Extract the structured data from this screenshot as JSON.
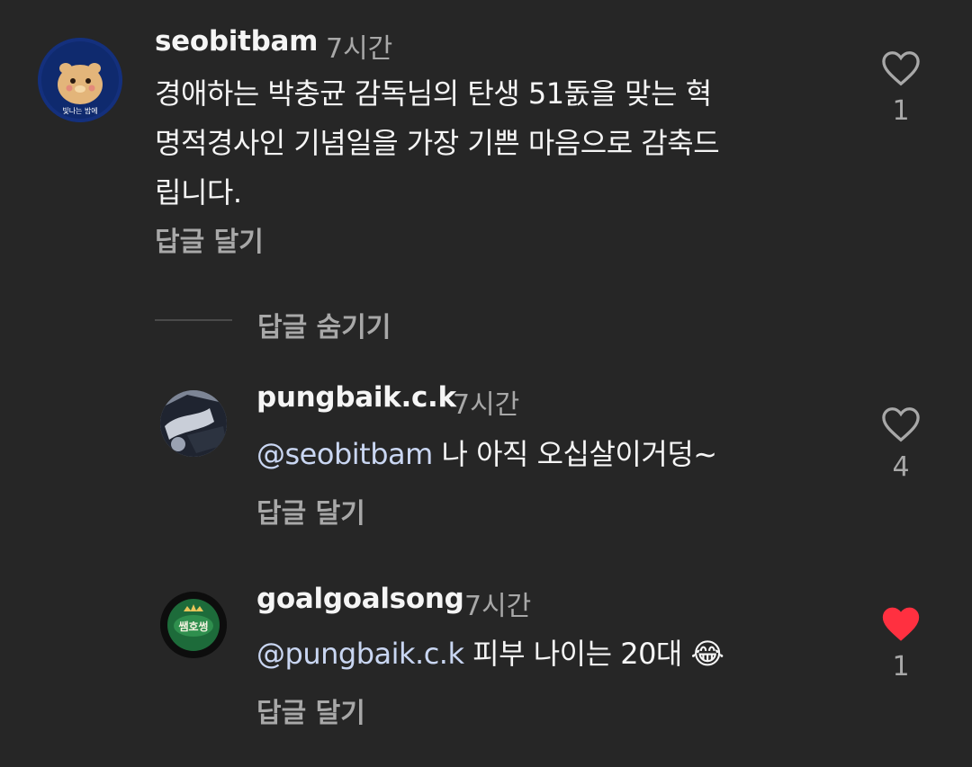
{
  "comments": [
    {
      "username": "seobitbam",
      "time": "7시간",
      "lines": [
        "경애하는 박충균 감독님의 탄생 51돐을 맞는 혁",
        "명적경사인 기념일을 가장 기쁜 마음으로 감축드",
        "립니다."
      ],
      "reply_label": "답글 달기",
      "likes": "1",
      "liked": false,
      "avatar_text": "빛나는 밤에"
    }
  ],
  "hide_replies_label": "답글 숨기기",
  "replies": [
    {
      "username": "pungbaik.c.k",
      "time": "7시간",
      "mention": "@seobitbam",
      "text": " 나 아직 오십살이거덩~",
      "reply_label": "답글 달기",
      "likes": "4",
      "liked": false
    },
    {
      "username": "goalgoalsong",
      "time": "7시간",
      "mention": "@pungbaik.c.k",
      "text": " 피부 나이는 20대 😂",
      "reply_label": "답글 달기",
      "likes": "1",
      "liked": true,
      "avatar_text": "쌤호썽"
    }
  ],
  "colors": {
    "background": "#262626",
    "text": "#f5f5f5",
    "secondary": "#a8a8a8",
    "liked": "#ff3040"
  },
  "icons": [
    "heart-outline-icon",
    "heart-filled-icon"
  ]
}
